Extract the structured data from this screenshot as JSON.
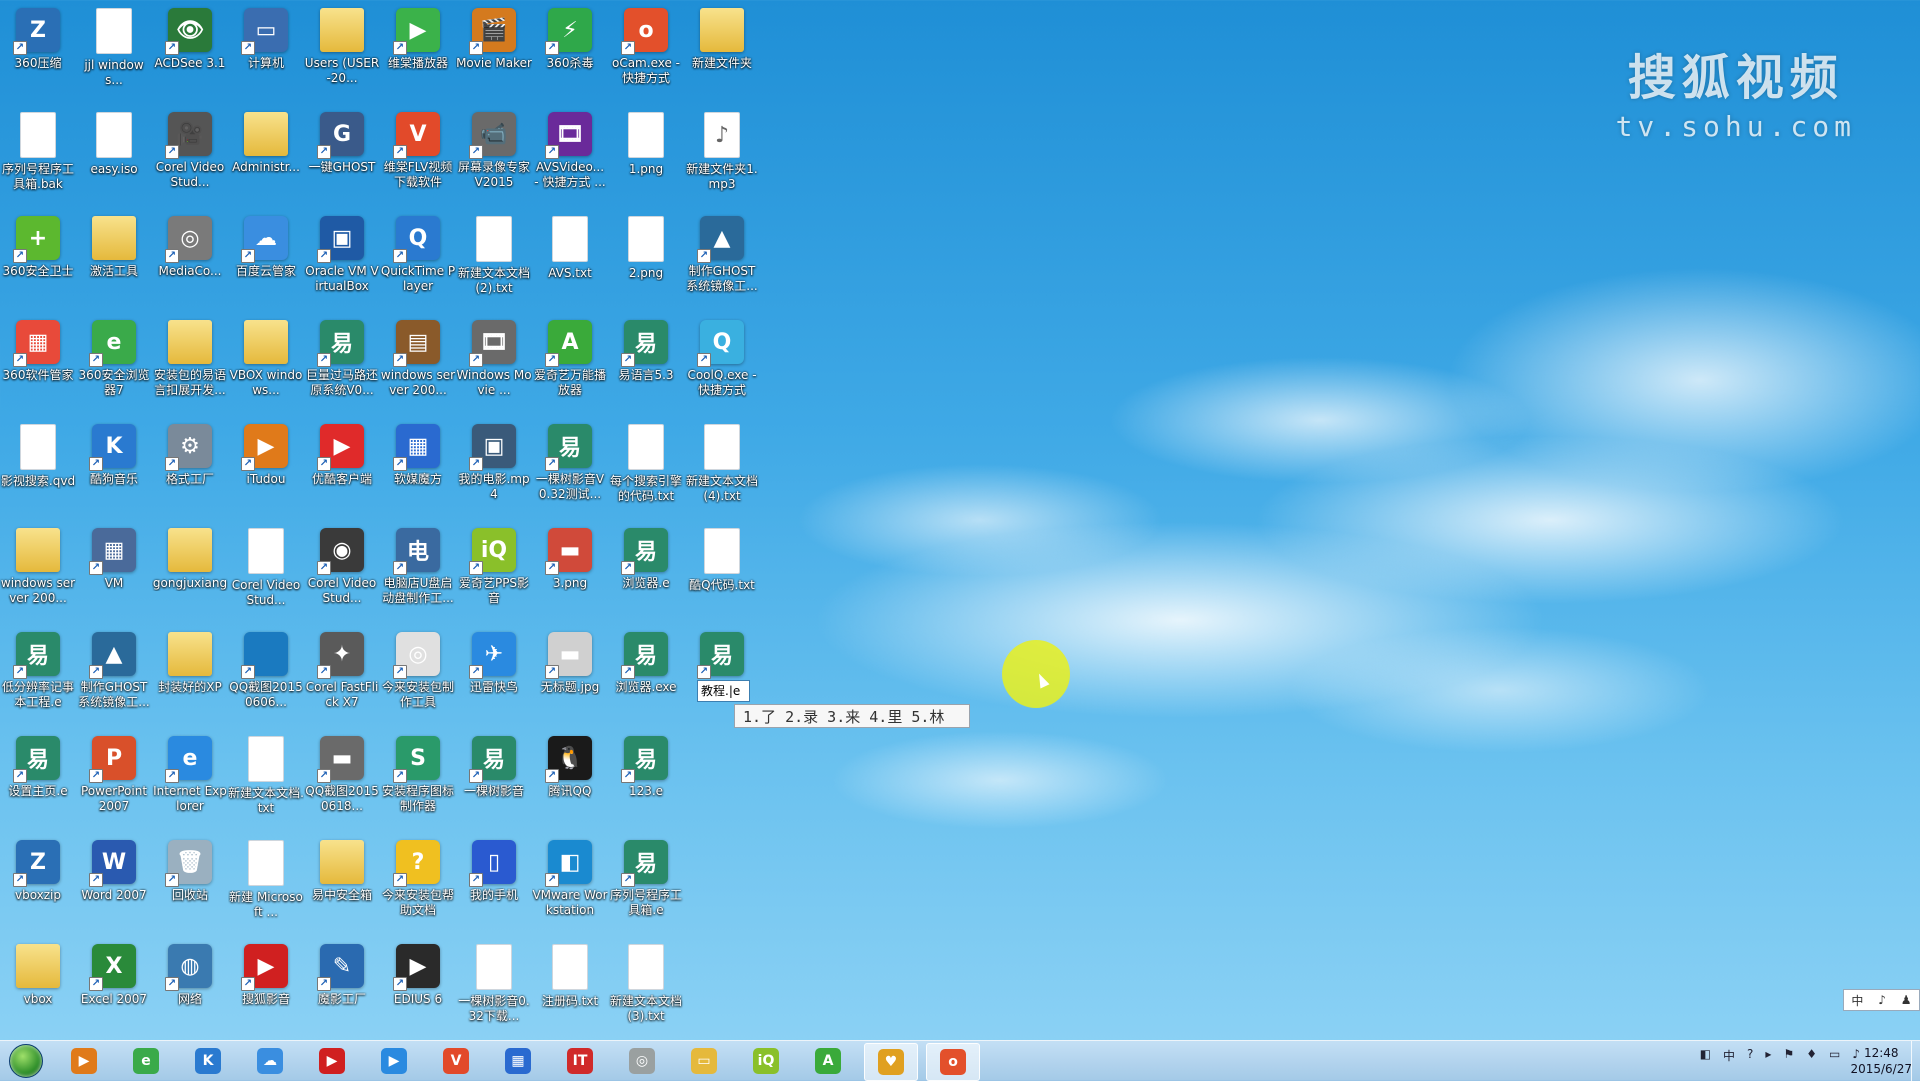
{
  "watermark": {
    "brand": "搜狐视频",
    "url": "tv.sohu.com"
  },
  "desktop_icons": [
    {
      "label": "360压缩",
      "kind": "app",
      "color": "#2a6fb5",
      "glyph": "Z"
    },
    {
      "label": "jjl windows...",
      "kind": "file",
      "color": "#ffffff",
      "glyph": ""
    },
    {
      "label": "ACDSee 3.1",
      "kind": "app",
      "color": "#2a7a3a",
      "glyph": "👁"
    },
    {
      "label": "计算机",
      "kind": "app",
      "color": "#3a6db0",
      "glyph": "▭"
    },
    {
      "label": "Users (USER-20...",
      "kind": "folder",
      "color": "#e5b93c",
      "glyph": ""
    },
    {
      "label": "维棠播放器",
      "kind": "app",
      "color": "#3bb24a",
      "glyph": "▶"
    },
    {
      "label": "Movie Maker",
      "kind": "app",
      "color": "#d47a1e",
      "glyph": "🎬"
    },
    {
      "label": "360杀毒",
      "kind": "app",
      "color": "#2fa84a",
      "glyph": "⚡"
    },
    {
      "label": "oCam.exe - 快捷方式",
      "kind": "app",
      "color": "#e3502b",
      "glyph": "o"
    },
    {
      "label": "新建文件夹",
      "kind": "folder",
      "color": "#e5b93c",
      "glyph": ""
    },
    {
      "label": "序列号程序工具箱.bak",
      "kind": "file",
      "color": "#ffffff",
      "glyph": ""
    },
    {
      "label": "easy.iso",
      "kind": "file",
      "color": "#ffffff",
      "glyph": ""
    },
    {
      "label": "Corel VideoStud...",
      "kind": "app",
      "color": "#555555",
      "glyph": "🎥"
    },
    {
      "label": "Administr...",
      "kind": "folder",
      "color": "#e5b93c",
      "glyph": ""
    },
    {
      "label": "一键GHOST",
      "kind": "app",
      "color": "#3a5a8a",
      "glyph": "G"
    },
    {
      "label": "维棠FLV视频下载软件",
      "kind": "app",
      "color": "#e24a2a",
      "glyph": "V"
    },
    {
      "label": "屏幕录像专家V2015",
      "kind": "app",
      "color": "#6a6a6a",
      "glyph": "📹"
    },
    {
      "label": "AVSVideo... - 快捷方式 ...",
      "kind": "app",
      "color": "#6a2a9a",
      "glyph": "🎞"
    },
    {
      "label": "1.png",
      "kind": "file",
      "color": "#ffffff",
      "glyph": ""
    },
    {
      "label": "新建文件夹1.mp3",
      "kind": "file",
      "color": "#ffffff",
      "glyph": "♪"
    },
    {
      "label": "360安全卫士",
      "kind": "app",
      "color": "#5cb82f",
      "glyph": "+"
    },
    {
      "label": "激活工具",
      "kind": "folder",
      "color": "#e5b93c",
      "glyph": ""
    },
    {
      "label": "MediaCo...",
      "kind": "app",
      "color": "#7a7a7a",
      "glyph": "◎"
    },
    {
      "label": "百度云管家",
      "kind": "app",
      "color": "#3a8ee0",
      "glyph": "☁"
    },
    {
      "label": "Oracle VM VirtualBox",
      "kind": "app",
      "color": "#1f5aa5",
      "glyph": "▣"
    },
    {
      "label": "QuickTime Player",
      "kind": "app",
      "color": "#2a7ad0",
      "glyph": "Q"
    },
    {
      "label": "新建文本文档(2).txt",
      "kind": "file",
      "color": "#ffffff",
      "glyph": ""
    },
    {
      "label": "AVS.txt",
      "kind": "file",
      "color": "#ffffff",
      "glyph": ""
    },
    {
      "label": "2.png",
      "kind": "file",
      "color": "#ffffff",
      "glyph": ""
    },
    {
      "label": "制作GHOST系统镜像工...",
      "kind": "app",
      "color": "#2a6a9a",
      "glyph": "▲"
    },
    {
      "label": "360软件管家",
      "kind": "app",
      "color": "#e84a3a",
      "glyph": "▦"
    },
    {
      "label": "360安全浏览器7",
      "kind": "app",
      "color": "#3aaa4a",
      "glyph": "e"
    },
    {
      "label": "安装包的易语言扣展开发...",
      "kind": "folder",
      "color": "#e5b93c",
      "glyph": ""
    },
    {
      "label": "VBOX windows...",
      "kind": "folder",
      "color": "#e5b93c",
      "glyph": ""
    },
    {
      "label": "巨量过马路还原系统V0...",
      "kind": "app",
      "color": "#2a8a6a",
      "glyph": "易"
    },
    {
      "label": "windows server 200...",
      "kind": "app",
      "color": "#8a5a2a",
      "glyph": "▤"
    },
    {
      "label": "Windows Movie ...",
      "kind": "app",
      "color": "#6a6a6a",
      "glyph": "🎞"
    },
    {
      "label": "爱奇艺万能播放器",
      "kind": "app",
      "color": "#3aaa3a",
      "glyph": "A"
    },
    {
      "label": "易语言5.3",
      "kind": "app",
      "color": "#2a8a6a",
      "glyph": "易"
    },
    {
      "label": "CoolQ.exe - 快捷方式",
      "kind": "app",
      "color": "#3ab0e0",
      "glyph": "Q"
    },
    {
      "label": "影视搜索.qvd",
      "kind": "file",
      "color": "#ffffff",
      "glyph": ""
    },
    {
      "label": "酷狗音乐",
      "kind": "app",
      "color": "#2a7ad0",
      "glyph": "K"
    },
    {
      "label": "格式工厂",
      "kind": "app",
      "color": "#7a8a9a",
      "glyph": "⚙"
    },
    {
      "label": "iTudou",
      "kind": "app",
      "color": "#e07a1a",
      "glyph": "▶"
    },
    {
      "label": "优酷客户端",
      "kind": "app",
      "color": "#e02a2a",
      "glyph": "▶"
    },
    {
      "label": "软媒魔方",
      "kind": "app",
      "color": "#2a6ad0",
      "glyph": "▦"
    },
    {
      "label": "我的电影.mp4",
      "kind": "app",
      "color": "#3a5a7a",
      "glyph": "▣"
    },
    {
      "label": "一棵树影音V0.32测试...",
      "kind": "app",
      "color": "#2a8a6a",
      "glyph": "易"
    },
    {
      "label": "每个搜索引擎的代码.txt",
      "kind": "file",
      "color": "#ffffff",
      "glyph": ""
    },
    {
      "label": "新建文本文档(4).txt",
      "kind": "file",
      "color": "#ffffff",
      "glyph": ""
    },
    {
      "label": "windows server 200...",
      "kind": "folder",
      "color": "#e5b93c",
      "glyph": ""
    },
    {
      "label": "VM",
      "kind": "app",
      "color": "#4a6a9a",
      "glyph": "▦"
    },
    {
      "label": "gongjuxiang",
      "kind": "folder",
      "color": "#e5b93c",
      "glyph": ""
    },
    {
      "label": "Corel VideoStud...",
      "kind": "file",
      "color": "#ffffff",
      "glyph": ""
    },
    {
      "label": "Corel VideoStud...",
      "kind": "app",
      "color": "#3a3a3a",
      "glyph": "◉"
    },
    {
      "label": "电脑店U盘启动盘制作工...",
      "kind": "app",
      "color": "#3a6aa0",
      "glyph": "电"
    },
    {
      "label": "爱奇艺PPS影音",
      "kind": "app",
      "color": "#8ac02a",
      "glyph": "iQ"
    },
    {
      "label": "3.png",
      "kind": "app",
      "color": "#d04a3a",
      "glyph": "▬"
    },
    {
      "label": "浏览器.e",
      "kind": "app",
      "color": "#2a8a6a",
      "glyph": "易"
    },
    {
      "label": "酷Q代码.txt",
      "kind": "file",
      "color": "#ffffff",
      "glyph": ""
    },
    {
      "label": "低分辨率记事本工程.e",
      "kind": "app",
      "color": "#2a8a6a",
      "glyph": "易"
    },
    {
      "label": "制作GHOST系统镜像工...",
      "kind": "app",
      "color": "#2a6a9a",
      "glyph": "▲"
    },
    {
      "label": "封装好的XP",
      "kind": "folder",
      "color": "#e5b93c",
      "glyph": ""
    },
    {
      "label": "QQ截图20150606...",
      "kind": "app",
      "color": "#1a7ac0",
      "glyph": ""
    },
    {
      "label": "Corel FastFlick X7",
      "kind": "app",
      "color": "#5a5a5a",
      "glyph": "✦"
    },
    {
      "label": "今来安装包制作工具",
      "kind": "app",
      "color": "#e0e0e0",
      "glyph": "◎"
    },
    {
      "label": "迅雷快鸟",
      "kind": "app",
      "color": "#2a8ae0",
      "glyph": "✈"
    },
    {
      "label": "无标题.jpg",
      "kind": "app",
      "color": "#d0d0d0",
      "glyph": "▬"
    },
    {
      "label": "浏览器.exe",
      "kind": "app",
      "color": "#2a8a6a",
      "glyph": "易"
    },
    {
      "label": "教程.e",
      "kind": "app",
      "color": "#2a8a6a",
      "glyph": "易"
    },
    {
      "label": "设置主页.e",
      "kind": "app",
      "color": "#2a8a6a",
      "glyph": "易"
    },
    {
      "label": "PowerPoint 2007",
      "kind": "app",
      "color": "#d9502a",
      "glyph": "P"
    },
    {
      "label": "Internet Explorer",
      "kind": "app",
      "color": "#2a8ae0",
      "glyph": "e"
    },
    {
      "label": "新建文本文档.txt",
      "kind": "file",
      "color": "#ffffff",
      "glyph": ""
    },
    {
      "label": "QQ截图20150618...",
      "kind": "app",
      "color": "#6a6a6a",
      "glyph": "▬"
    },
    {
      "label": "安装程序图标制作器",
      "kind": "app",
      "color": "#2a9a6a",
      "glyph": "S"
    },
    {
      "label": "一棵树影音",
      "kind": "app",
      "color": "#2a8a6a",
      "glyph": "易"
    },
    {
      "label": "腾讯QQ",
      "kind": "app",
      "color": "#1a1a1a",
      "glyph": "🐧"
    },
    {
      "label": "123.e",
      "kind": "app",
      "color": "#2a8a6a",
      "glyph": "易"
    },
    {
      "label": "",
      "kind": "none",
      "color": "",
      "glyph": ""
    },
    {
      "label": "vboxzip",
      "kind": "app",
      "color": "#2a6fb5",
      "glyph": "Z"
    },
    {
      "label": "Word 2007",
      "kind": "app",
      "color": "#2a5ab0",
      "glyph": "W"
    },
    {
      "label": "回收站",
      "kind": "app",
      "color": "#9ab0c0",
      "glyph": "🗑"
    },
    {
      "label": "新建 Microsoft ...",
      "kind": "file",
      "color": "#ffffff",
      "glyph": ""
    },
    {
      "label": "易中安全箱",
      "kind": "folder",
      "color": "#e5b93c",
      "glyph": ""
    },
    {
      "label": "今来安装包帮助文档",
      "kind": "app",
      "color": "#f0c020",
      "glyph": "?"
    },
    {
      "label": "我的手机",
      "kind": "app",
      "color": "#2a5ad0",
      "glyph": "▯"
    },
    {
      "label": "VMware Workstation",
      "kind": "app",
      "color": "#1a8ad0",
      "glyph": "◧"
    },
    {
      "label": "序列号程序工具箱.e",
      "kind": "app",
      "color": "#2a8a6a",
      "glyph": "易"
    },
    {
      "label": "",
      "kind": "none",
      "color": "",
      "glyph": ""
    },
    {
      "label": "vbox",
      "kind": "folder",
      "color": "#e5b93c",
      "glyph": ""
    },
    {
      "label": "Excel 2007",
      "kind": "app",
      "color": "#2a8a3a",
      "glyph": "X"
    },
    {
      "label": "网络",
      "kind": "app",
      "color": "#3a7ab0",
      "glyph": "◍"
    },
    {
      "label": "搜狐影音",
      "kind": "app",
      "color": "#d02020",
      "glyph": "▶"
    },
    {
      "label": "魔影工厂",
      "kind": "app",
      "color": "#2a6ab0",
      "glyph": "✎"
    },
    {
      "label": "EDIUS 6",
      "kind": "app",
      "color": "#2a2a2a",
      "glyph": "▶"
    },
    {
      "label": "一棵树影音0.32下载...",
      "kind": "file",
      "color": "#ffffff",
      "glyph": ""
    },
    {
      "label": "注册码.txt",
      "kind": "file",
      "color": "#ffffff",
      "glyph": ""
    },
    {
      "label": "新建文本文档(3).txt",
      "kind": "file",
      "color": "#ffffff",
      "glyph": ""
    },
    {
      "label": "",
      "kind": "none",
      "color": "",
      "glyph": ""
    }
  ],
  "rename_box": {
    "value": "教程.|e"
  },
  "ime_candidates": {
    "text": "1.了  2.录 3.来 4.里 5.林"
  },
  "language_bar": {
    "items": [
      "中",
      "♪",
      "♟"
    ]
  },
  "taskbar": {
    "items": [
      {
        "name": "media-player",
        "color": "#e07a1a",
        "glyph": "▶",
        "active": false
      },
      {
        "name": "360-browser",
        "color": "#3aaa4a",
        "glyph": "e",
        "active": false
      },
      {
        "name": "kugou",
        "color": "#2a7ad0",
        "glyph": "K",
        "active": false
      },
      {
        "name": "baidu-cloud",
        "color": "#3a8ee0",
        "glyph": "☁",
        "active": false
      },
      {
        "name": "sohu-player",
        "color": "#d02020",
        "glyph": "▶",
        "active": false
      },
      {
        "name": "youku",
        "color": "#2a8ae0",
        "glyph": "▶",
        "active": false
      },
      {
        "name": "weitang",
        "color": "#e24a2a",
        "glyph": "V",
        "active": false
      },
      {
        "name": "ruanmei",
        "color": "#2a6ad0",
        "glyph": "▦",
        "active": false
      },
      {
        "name": "tt",
        "color": "#d02a2a",
        "glyph": "IT",
        "active": false
      },
      {
        "name": "installer",
        "color": "#9aa0a0",
        "glyph": "◎",
        "active": false
      },
      {
        "name": "explorer",
        "color": "#e5b93c",
        "glyph": "▭",
        "active": false
      },
      {
        "name": "iqiyi",
        "color": "#8ac02a",
        "glyph": "iQ",
        "active": false
      },
      {
        "name": "aiqiyi-player",
        "color": "#3aaa3a",
        "glyph": "A",
        "active": false
      },
      {
        "name": "chrome-like",
        "color": "#e0a020",
        "glyph": "♥",
        "active": true
      },
      {
        "name": "ocam",
        "color": "#e3502b",
        "glyph": "o",
        "active": true
      }
    ],
    "tray": [
      "◧",
      "中",
      "?",
      "▸",
      "⚑",
      "♦",
      "▭",
      "♪"
    ],
    "time": "12:48",
    "date": "2015/6/27"
  }
}
